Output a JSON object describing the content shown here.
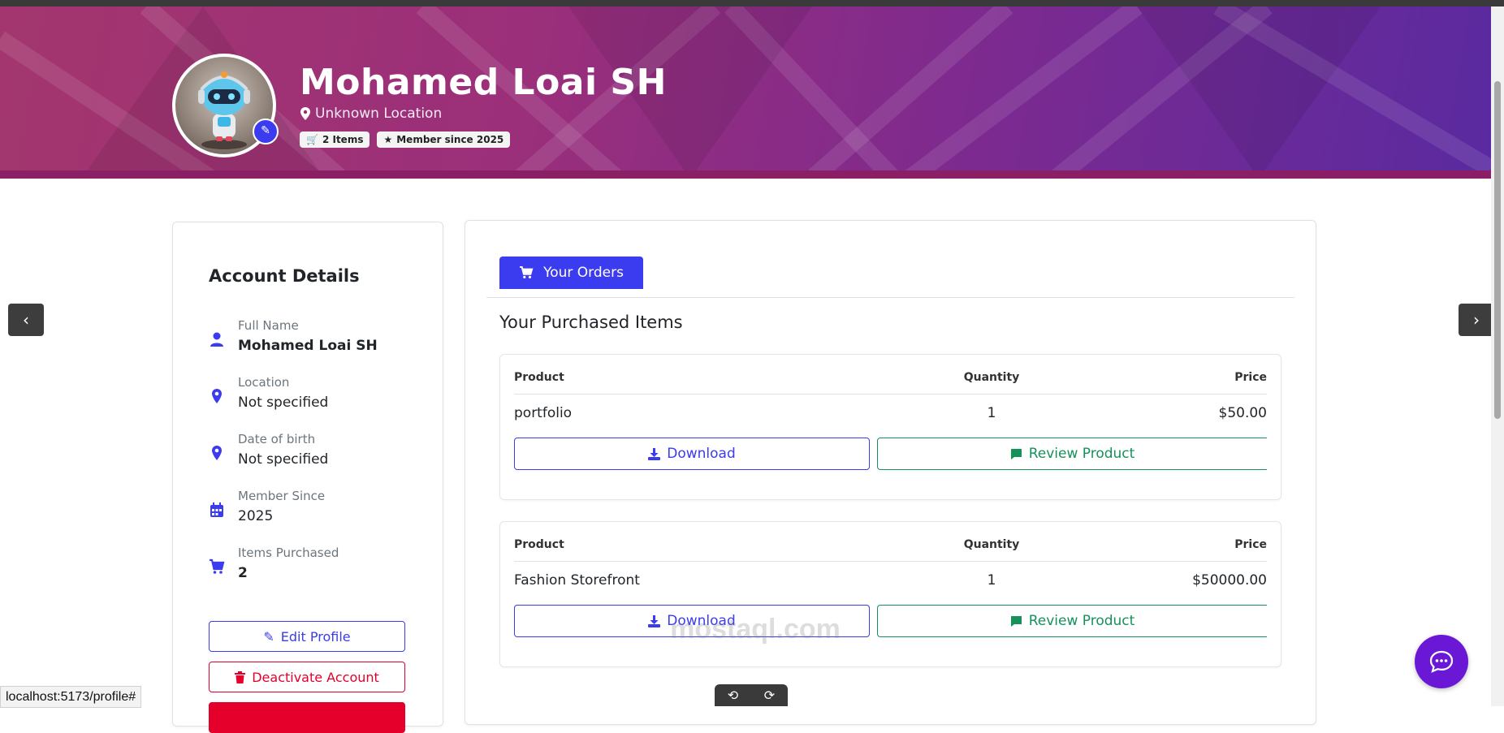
{
  "profile": {
    "name": "Mohamed Loai SH",
    "location": "Unknown Location",
    "badges": {
      "items": "2 Items",
      "member": "Member since 2025"
    }
  },
  "account": {
    "title": "Account Details",
    "details": [
      {
        "label": "Full Name",
        "value": "Mohamed Loai SH",
        "icon": "person-icon"
      },
      {
        "label": "Location",
        "value": "Not specified",
        "icon": "map-pin-icon"
      },
      {
        "label": "Date of birth",
        "value": "Not specified",
        "icon": "map-pin-icon"
      },
      {
        "label": "Member Since",
        "value": "2025",
        "icon": "calendar-icon"
      },
      {
        "label": "Items Purchased",
        "value": "2",
        "icon": "cart-icon"
      }
    ],
    "edit_label": "Edit Profile",
    "deactivate_label": "Deactivate Account"
  },
  "orders": {
    "tab_label": "Your Orders",
    "section_title": "Your Purchased Items",
    "headers": {
      "product": "Product",
      "quantity": "Quantity",
      "price": "Price"
    },
    "items": [
      {
        "product": "portfolio",
        "quantity": "1",
        "price": "$50.00"
      },
      {
        "product": "Fashion Storefront",
        "quantity": "1",
        "price": "$50000.00"
      }
    ],
    "download_label": "Download",
    "review_label": "Review Product"
  },
  "browser": {
    "status_url": "localhost:5173/profile#"
  },
  "watermark": "mostaql.com",
  "colors": {
    "accent": "#3b3bf0",
    "danger": "#e4002b",
    "success": "#15915a",
    "chat": "#6a18d6"
  }
}
